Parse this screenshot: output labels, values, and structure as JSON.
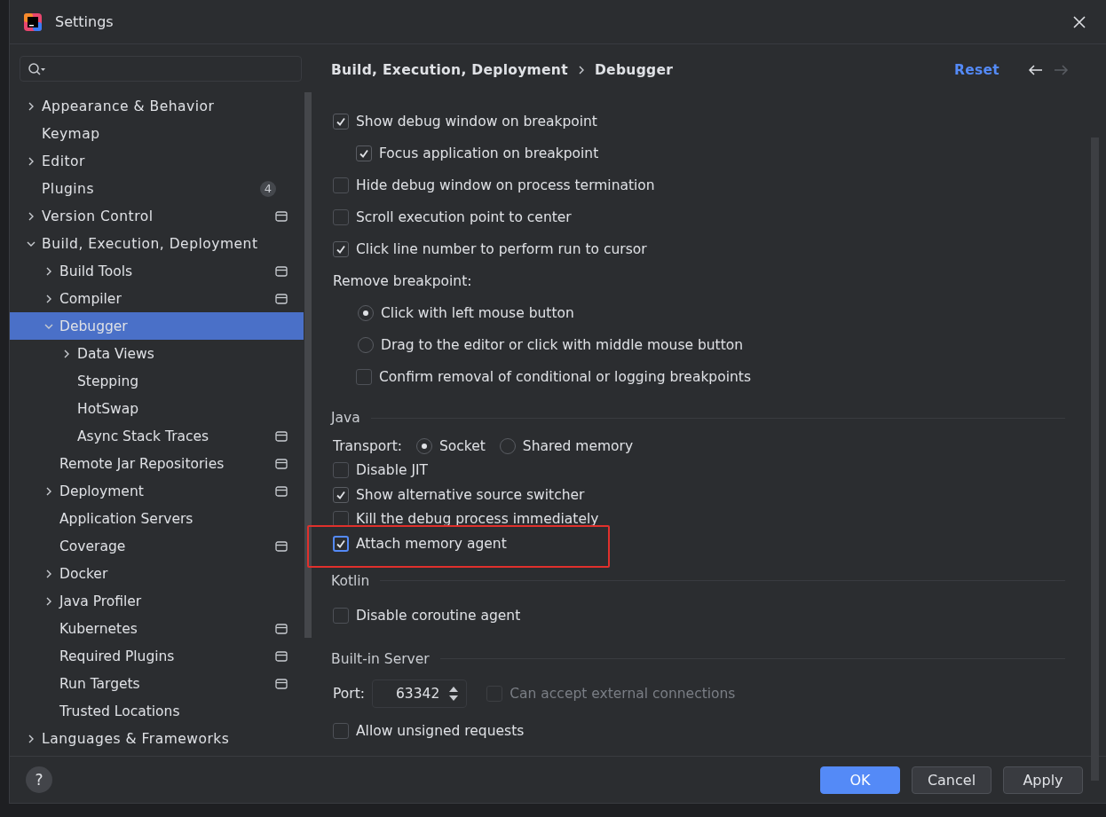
{
  "window": {
    "title": "Settings"
  },
  "sidebar": {
    "tree": [
      {
        "label": "Appearance & Behavior",
        "expanded": false,
        "selected": false,
        "project_level": false
      },
      {
        "label": "Keymap",
        "selected": false,
        "project_level": false
      },
      {
        "label": "Editor",
        "expanded": false,
        "selected": false,
        "project_level": false
      },
      {
        "label": "Plugins",
        "selected": false,
        "project_level": false,
        "badge": "4"
      },
      {
        "label": "Version Control",
        "expanded": false,
        "selected": false,
        "project_level": true
      },
      {
        "label": "Build, Execution, Deployment",
        "expanded": true,
        "selected": false,
        "project_level": false,
        "children": [
          {
            "label": "Build Tools",
            "expanded": false,
            "selected": false,
            "project_level": true
          },
          {
            "label": "Compiler",
            "expanded": false,
            "selected": false,
            "project_level": true
          },
          {
            "label": "Debugger",
            "expanded": true,
            "selected": true,
            "project_level": false,
            "children": [
              {
                "label": "Data Views",
                "expanded": false,
                "selected": false,
                "project_level": false
              },
              {
                "label": "Stepping",
                "selected": false,
                "project_level": false
              },
              {
                "label": "HotSwap",
                "selected": false,
                "project_level": false
              },
              {
                "label": "Async Stack Traces",
                "selected": false,
                "project_level": true
              }
            ]
          },
          {
            "label": "Remote Jar Repositories",
            "selected": false,
            "project_level": true
          },
          {
            "label": "Deployment",
            "expanded": false,
            "selected": false,
            "project_level": true
          },
          {
            "label": "Application Servers",
            "selected": false,
            "project_level": false
          },
          {
            "label": "Coverage",
            "selected": false,
            "project_level": true
          },
          {
            "label": "Docker",
            "expanded": false,
            "selected": false,
            "project_level": false
          },
          {
            "label": "Java Profiler",
            "expanded": false,
            "selected": false,
            "project_level": false
          },
          {
            "label": "Kubernetes",
            "selected": false,
            "project_level": true
          },
          {
            "label": "Required Plugins",
            "selected": false,
            "project_level": true
          },
          {
            "label": "Run Targets",
            "selected": false,
            "project_level": true
          },
          {
            "label": "Trusted Locations",
            "selected": false,
            "project_level": false
          }
        ]
      },
      {
        "label": "Languages & Frameworks",
        "expanded": false,
        "selected": false,
        "project_level": false
      }
    ]
  },
  "content": {
    "breadcrumb": [
      "Build, Execution, Deployment",
      "Debugger"
    ],
    "reset": "Reset",
    "groups": [
      {
        "options": [
          {
            "kind": "checkbox",
            "label": "Show debug window on breakpoint",
            "checked": true,
            "focused": false,
            "disabled": false,
            "highlighted": false,
            "children": [
              {
                "kind": "checkbox",
                "label": "Focus application on breakpoint",
                "checked": true,
                "focused": false,
                "disabled": false,
                "highlighted": false
              }
            ]
          },
          {
            "kind": "checkbox",
            "label": "Hide debug window on process termination",
            "checked": false,
            "focused": false,
            "disabled": false,
            "highlighted": false
          },
          {
            "kind": "checkbox",
            "label": "Scroll execution point to center",
            "checked": false,
            "focused": false,
            "disabled": false,
            "highlighted": false
          },
          {
            "kind": "checkbox",
            "label": "Click line number to perform run to cursor",
            "checked": true,
            "focused": false,
            "disabled": false,
            "highlighted": false
          },
          {
            "kind": "label",
            "label": "Remove breakpoint:",
            "children": [
              {
                "kind": "radio",
                "label": "Click with left mouse button",
                "selected": true
              },
              {
                "kind": "radio",
                "label": "Drag to the editor or click with middle mouse button",
                "selected": false
              },
              {
                "kind": "checkbox",
                "label": "Confirm removal of conditional or logging breakpoints",
                "checked": false,
                "focused": false,
                "disabled": false,
                "highlighted": false
              }
            ]
          }
        ]
      },
      {
        "title": "Java",
        "options": [
          {
            "kind": "radio_group",
            "label": "Transport:",
            "choices": [
              {
                "label": "Socket",
                "selected": true
              },
              {
                "label": "Shared memory",
                "selected": false
              }
            ]
          },
          {
            "kind": "checkbox",
            "label": "Disable JIT",
            "checked": false,
            "focused": false,
            "disabled": false,
            "highlighted": false
          },
          {
            "kind": "checkbox",
            "label": "Show alternative source switcher",
            "checked": true,
            "focused": false,
            "disabled": false,
            "highlighted": false
          },
          {
            "kind": "checkbox",
            "label": "Kill the debug process immediately",
            "checked": false,
            "focused": false,
            "disabled": false,
            "highlighted": false
          },
          {
            "kind": "checkbox",
            "label": "Attach memory agent",
            "checked": true,
            "focused": true,
            "disabled": false,
            "highlighted": true
          }
        ]
      },
      {
        "title": "Kotlin",
        "options": [
          {
            "kind": "checkbox",
            "label": "Disable coroutine agent",
            "checked": false,
            "focused": false,
            "disabled": false,
            "highlighted": false
          }
        ]
      },
      {
        "title": "Built-in Server",
        "options": [
          {
            "kind": "port",
            "label": "Port:",
            "value": "63342",
            "option": {
              "kind": "checkbox",
              "label": "Can accept external connections",
              "checked": false,
              "focused": false,
              "disabled": true,
              "highlighted": false
            }
          },
          {
            "kind": "checkbox",
            "label": "Allow unsigned requests",
            "checked": false,
            "focused": false,
            "disabled": false,
            "highlighted": false
          }
        ]
      }
    ]
  },
  "help": "?",
  "buttons": [
    {
      "label": "OK",
      "default": true
    },
    {
      "label": "Cancel",
      "default": false
    },
    {
      "label": "Apply",
      "default": false
    }
  ]
}
